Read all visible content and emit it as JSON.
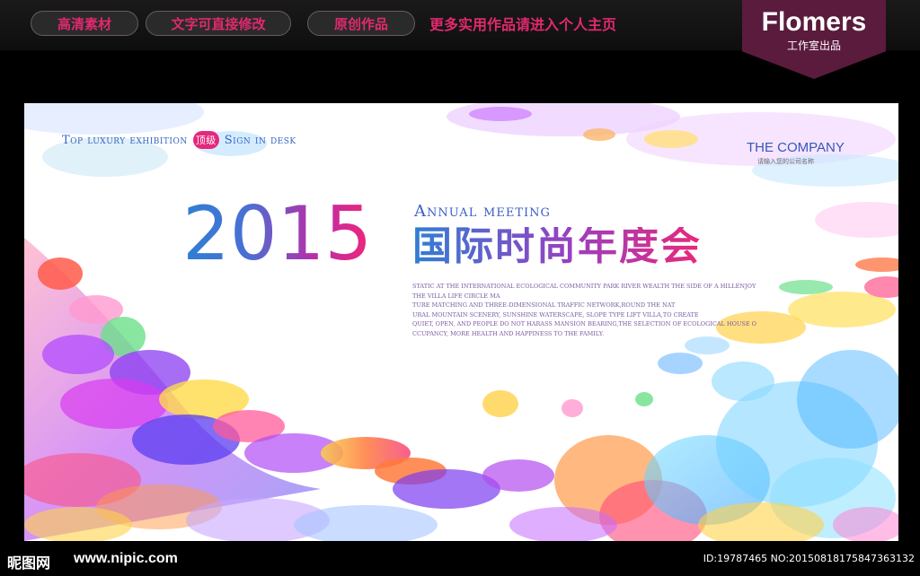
{
  "topbar": {
    "pills": [
      "高清素材",
      "文字可直接修改",
      "原创作品"
    ],
    "promo": "更多实用作品请进入个人主页"
  },
  "brand": {
    "name": "Flomers",
    "sub": "工作室出品"
  },
  "banner": {
    "tagline_left": "Top luxury exhibition",
    "tagline_badge": "顶级",
    "tagline_right": "Sign in desk",
    "company": "THE COMPANY",
    "company_sub": "请输入您的公司名称",
    "year": "2015",
    "annual": "Annual meeting",
    "cn_title": "国际时尚年度会",
    "body_lines": [
      "STATIC AT THE INTERNATIONAL ECOLOGICAL COMMUNITY PARK RIVER WEALTH THE SIDE OF A HILLENJOY",
      "THE VILLA LIFE CIRCLE MA",
      "TURE MATCHING AND THREE-DIMENSIONAL TRAFFIC NETWORK,ROUND THE NAT",
      "URAL MOUNTAIN SCENERY, SUNSHINE WATERSCAPE, SLOPE TYPE LIFT VILLA,TO CREATE",
      "QUIET, OPEN, AND PEOPLE DO NOT HARASS MANSION BEARING,THE SELECTION OF ECOLOGICAL HOUSE O",
      "CCUPANCY, MORE HEALTH AND HAPPINESS TO THE FAMILY."
    ]
  },
  "watermark": {
    "logo": "昵图网",
    "url": "www.nipic.com",
    "id": "ID:19787465 NO:20150818175847363132"
  },
  "colors": {
    "accent": "#e0296e",
    "brand_bg": "#5b1b3d",
    "title_blue": "#3466c4"
  }
}
